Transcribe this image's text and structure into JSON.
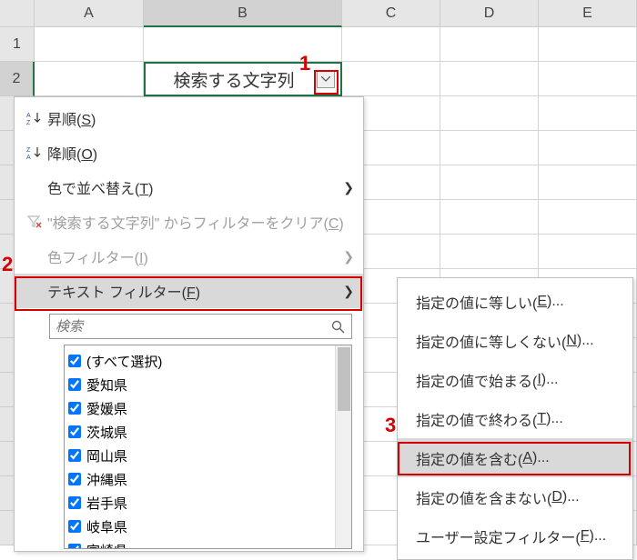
{
  "columns": [
    "A",
    "B",
    "C",
    "D",
    "E"
  ],
  "rows": [
    "1",
    "2"
  ],
  "cell_b2": {
    "label": "検索する文字列"
  },
  "callouts": {
    "one": "1",
    "two": "2",
    "three": "3"
  },
  "menu": {
    "sort_asc": "昇順(S)",
    "sort_desc": "降順(O)",
    "sort_by_color": "色で並べ替え(T)",
    "clear_filter": "\"検索する文字列\" からフィルターをクリア(C)",
    "color_filter": "色フィルター(I)",
    "text_filter": "テキスト フィルター(F)",
    "search_placeholder": "検索",
    "checks": [
      "(すべて選択)",
      "愛知県",
      "愛媛県",
      "茨城県",
      "岡山県",
      "沖縄県",
      "岩手県",
      "岐阜県",
      "宮崎県"
    ]
  },
  "submenu": {
    "equals": "指定の値に等しい(E)...",
    "not_equals": "指定の値に等しくない(N)...",
    "begins_with": "指定の値で始まる(I)...",
    "ends_with": "指定の値で終わる(T)...",
    "contains": "指定の値を含む(A)...",
    "not_contains": "指定の値を含まない(D)...",
    "custom": "ユーザー設定フィルター(F)..."
  }
}
